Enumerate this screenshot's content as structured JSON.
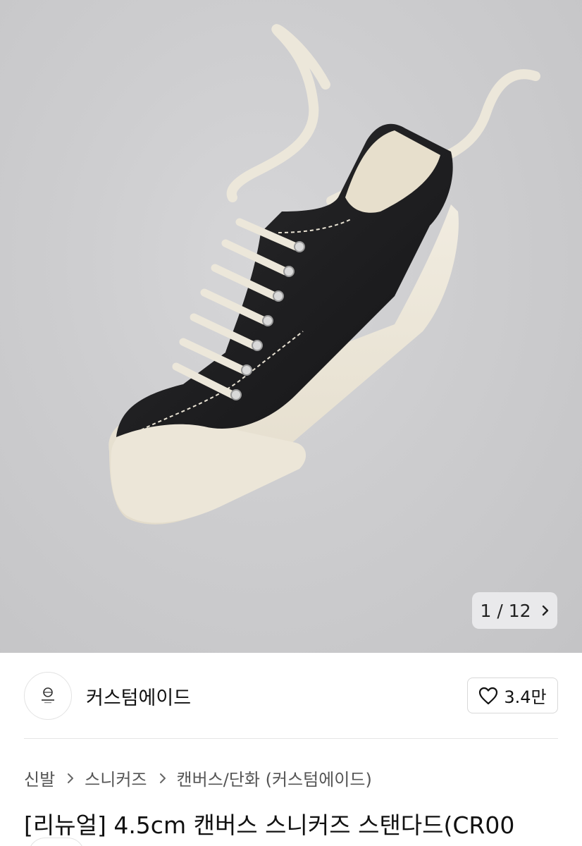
{
  "gallery": {
    "current": "1",
    "separator": "/",
    "total": "12",
    "counter_text": "1 / 12",
    "image_icon": "canvas-sneaker-photo",
    "next_icon": "chevron-right-icon"
  },
  "brand": {
    "name": "커스텀에이드",
    "logo_icon": "brand-logo-icon"
  },
  "likes": {
    "count": "3.4만",
    "icon": "heart-outline-icon"
  },
  "breadcrumb": {
    "items": [
      "신발",
      "스니커즈",
      "캔버스/단화 (커스텀에이드)"
    ],
    "separator_icon": "chevron-right-icon"
  },
  "product": {
    "title": "[리뉴얼] 4.5cm 캔버스 스니커즈 스탠다드(CR00"
  },
  "colors": {
    "background": "#ffffff",
    "hero_gray": "#cdcdcf",
    "text": "#111111",
    "muted": "#555555",
    "border": "#d8d8d8"
  }
}
